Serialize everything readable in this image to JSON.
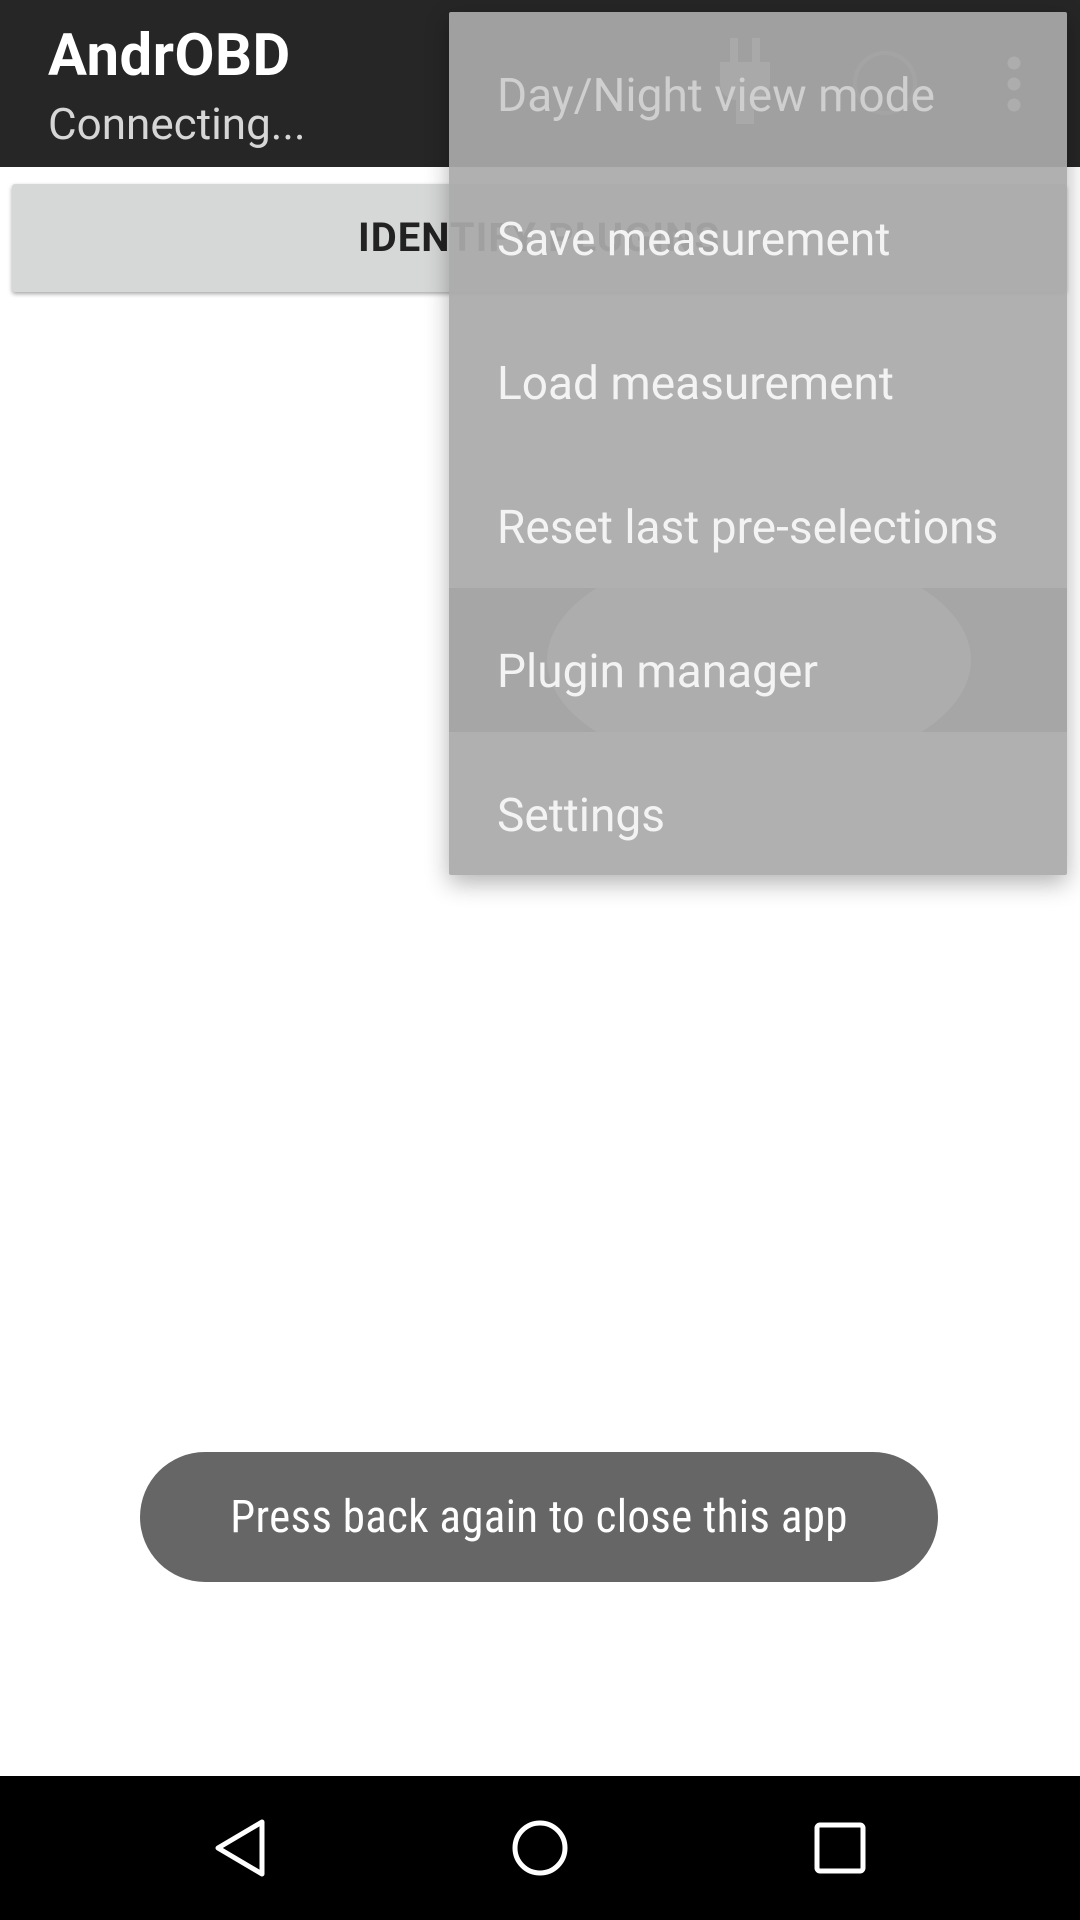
{
  "app_bar": {
    "title": "AndrOBD",
    "subtitle": "Connecting...",
    "actions": [
      "plug-icon",
      "circle-icon",
      "overflow-menu-icon"
    ]
  },
  "main": {
    "identify_button_label": "IDENTIFY PLUGINS"
  },
  "overflow_menu": {
    "items": [
      {
        "label": "Day/Night view mode"
      },
      {
        "label": "Save measurement"
      },
      {
        "label": "Load measurement"
      },
      {
        "label": "Reset last pre-selections"
      },
      {
        "label": "Plugin manager"
      },
      {
        "label": "Settings"
      }
    ]
  },
  "toast": {
    "message": "Press back again to close this app"
  },
  "nav_bar": {
    "buttons": [
      "back-icon",
      "home-icon",
      "recents-icon"
    ]
  },
  "colors": {
    "app_bar": "#262626",
    "menu": "#aaaaaa",
    "toast": "#666666",
    "nav_bar": "#000000",
    "button": "#d6d7d7"
  }
}
